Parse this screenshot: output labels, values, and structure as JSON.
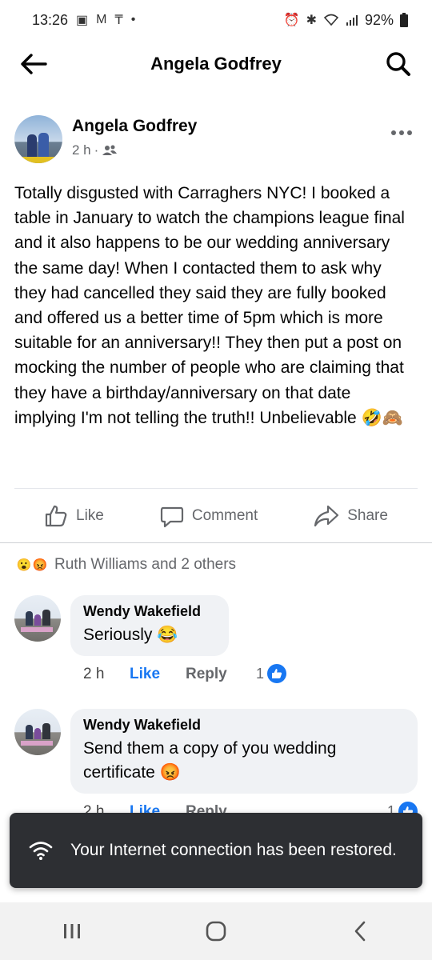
{
  "status_bar": {
    "time": "13:26",
    "battery": "92%"
  },
  "header": {
    "title": "Angela Godfrey"
  },
  "post": {
    "author": "Angela Godfrey",
    "time": "2 h",
    "separator": "·",
    "text": "Totally disgusted with Carraghers NYC!  I booked a table in January to watch the champions league final and it also happens to be our wedding anniversary the same day!  When I contacted them to ask why they had cancelled they said they are fully booked and offered us a better time of 5pm which is more suitable for an anniversary!! They then put a post on mocking the number of people who are claiming that they have a birthday/anniversary on that date implying I'm not telling the truth!! Unbelievable",
    "text_emojis": "🤣🙈"
  },
  "actions": {
    "like": "Like",
    "comment": "Comment",
    "share": "Share"
  },
  "reactions": {
    "emoji_1": "😮",
    "emoji_2": "😡",
    "summary": "Ruth Williams and 2 others"
  },
  "comments": [
    {
      "author": "Wendy Wakefield",
      "text": "Seriously",
      "emoji": "😂",
      "time": "2 h",
      "like_label": "Like",
      "reply_label": "Reply",
      "like_count": "1"
    },
    {
      "author": "Wendy Wakefield",
      "text_line1": "Send them a copy of you wedding",
      "text_line2": "certificate",
      "emoji": "😡",
      "time": "2 h",
      "like_label": "Like",
      "reply_label": "Reply",
      "like_count": "1"
    }
  ],
  "toast": {
    "message": "Your Internet connection has been restored."
  },
  "colors": {
    "accent": "#1877f2",
    "secondary_text": "#65676b",
    "bubble": "#f0f2f5",
    "toast_bg": "#2d2f33"
  },
  "icons": [
    "back-arrow-icon",
    "search-icon",
    "more-icon",
    "friends-icon",
    "like-icon",
    "comment-icon",
    "share-icon",
    "wifi-icon",
    "recent-apps-icon",
    "home-icon",
    "nav-back-icon"
  ]
}
